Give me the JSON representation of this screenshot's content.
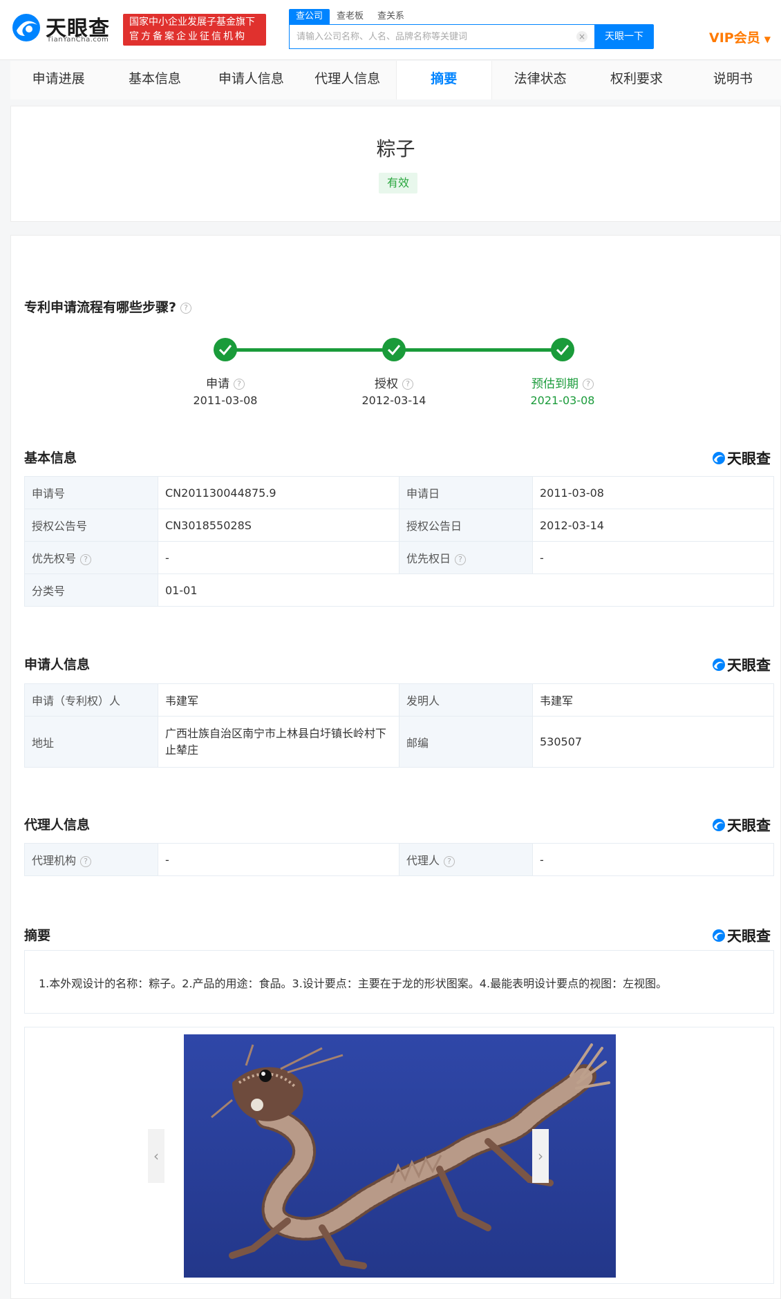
{
  "header": {
    "logo_text": "天眼查",
    "logo_sub": "TianYanCha.com",
    "badge_line1": "国家中小企业发展子基金旗下",
    "badge_line2": "官方备案企业征信机构",
    "search_tabs": [
      "查公司",
      "查老板",
      "查关系"
    ],
    "search_placeholder": "请输入公司名称、人名、品牌名称等关键词",
    "search_button": "天眼一下",
    "vip_label": "VIP会员"
  },
  "nav": {
    "items": [
      "申请进展",
      "基本信息",
      "申请人信息",
      "代理人信息",
      "摘要",
      "法律状态",
      "权利要求",
      "说明书"
    ],
    "active_index": 4
  },
  "patent": {
    "title": "粽子",
    "status": "有效"
  },
  "process": {
    "heading": "专利申请流程有哪些步骤?",
    "steps": [
      {
        "label": "申请",
        "date": "2011-03-08"
      },
      {
        "label": "授权",
        "date": "2012-03-14"
      },
      {
        "label": "预估到期",
        "date": "2021-03-08"
      }
    ]
  },
  "brand_text": "天眼查",
  "basic_info": {
    "heading": "基本信息",
    "rows": [
      {
        "k1": "申请号",
        "v1": "CN201130044875.9",
        "k2": "申请日",
        "v2": "2011-03-08"
      },
      {
        "k1": "授权公告号",
        "v1": "CN301855028S",
        "k2": "授权公告日",
        "v2": "2012-03-14"
      },
      {
        "k1": "优先权号",
        "v1": "-",
        "k2": "优先权日",
        "v2": "-"
      },
      {
        "k1": "分类号",
        "v1": "01-01"
      }
    ]
  },
  "applicant_info": {
    "heading": "申请人信息",
    "rows": [
      {
        "k1": "申请（专利权）人",
        "v1": "韦建军",
        "k2": "发明人",
        "v2": "韦建军"
      },
      {
        "k1": "地址",
        "v1": "广西壮族自治区南宁市上林县白圩镇长岭村下止辇庄",
        "k2": "邮编",
        "v2": "530507"
      }
    ]
  },
  "agent_info": {
    "heading": "代理人信息",
    "rows": [
      {
        "k1": "代理机构",
        "v1": "-",
        "k2": "代理人",
        "v2": "-"
      }
    ]
  },
  "abstract": {
    "heading": "摘要",
    "text": "1.本外观设计的名称：粽子。2.产品的用途：食品。3.设计要点：主要在于龙的形状图案。4.最能表明设计要点的视图：左视图。"
  },
  "gallery": {
    "prev": "‹",
    "next": "›"
  },
  "colors": {
    "accent": "#0084ff",
    "status_green": "#1a9b3a",
    "badge_red": "#e0312e",
    "vip_orange": "#ff7a00"
  }
}
